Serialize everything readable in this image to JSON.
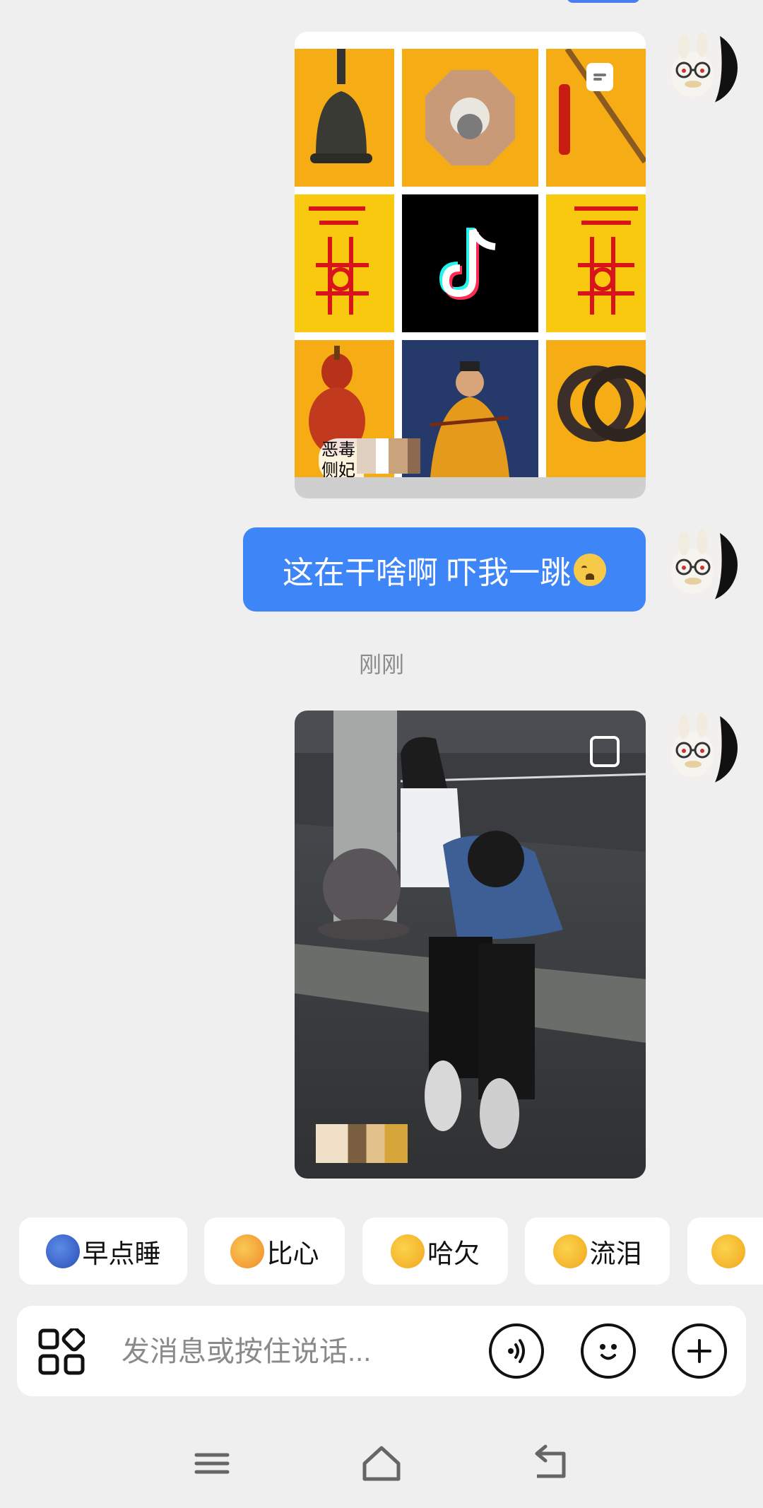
{
  "messages": [
    {
      "type": "image-grid",
      "overlay_text": "恶毒侧妃"
    },
    {
      "type": "text",
      "text": "这在干啥啊 吓我一跳"
    },
    {
      "type": "timestamp",
      "text": "刚刚"
    },
    {
      "type": "image-photo"
    }
  ],
  "quick_replies": [
    {
      "label": "早点睡",
      "icon": "sleepy-moon-emoji"
    },
    {
      "label": "比心",
      "icon": "heart-hands-emoji"
    },
    {
      "label": "哈欠",
      "icon": "yawn-emoji"
    },
    {
      "label": "流泪",
      "icon": "crying-emoji"
    },
    {
      "label": "",
      "icon": "pleading-emoji"
    }
  ],
  "input": {
    "placeholder": "发消息或按住说话..."
  },
  "colors": {
    "bubble": "#3e86f7",
    "background": "#efefef",
    "grid_yellow": "#f6ac14"
  }
}
